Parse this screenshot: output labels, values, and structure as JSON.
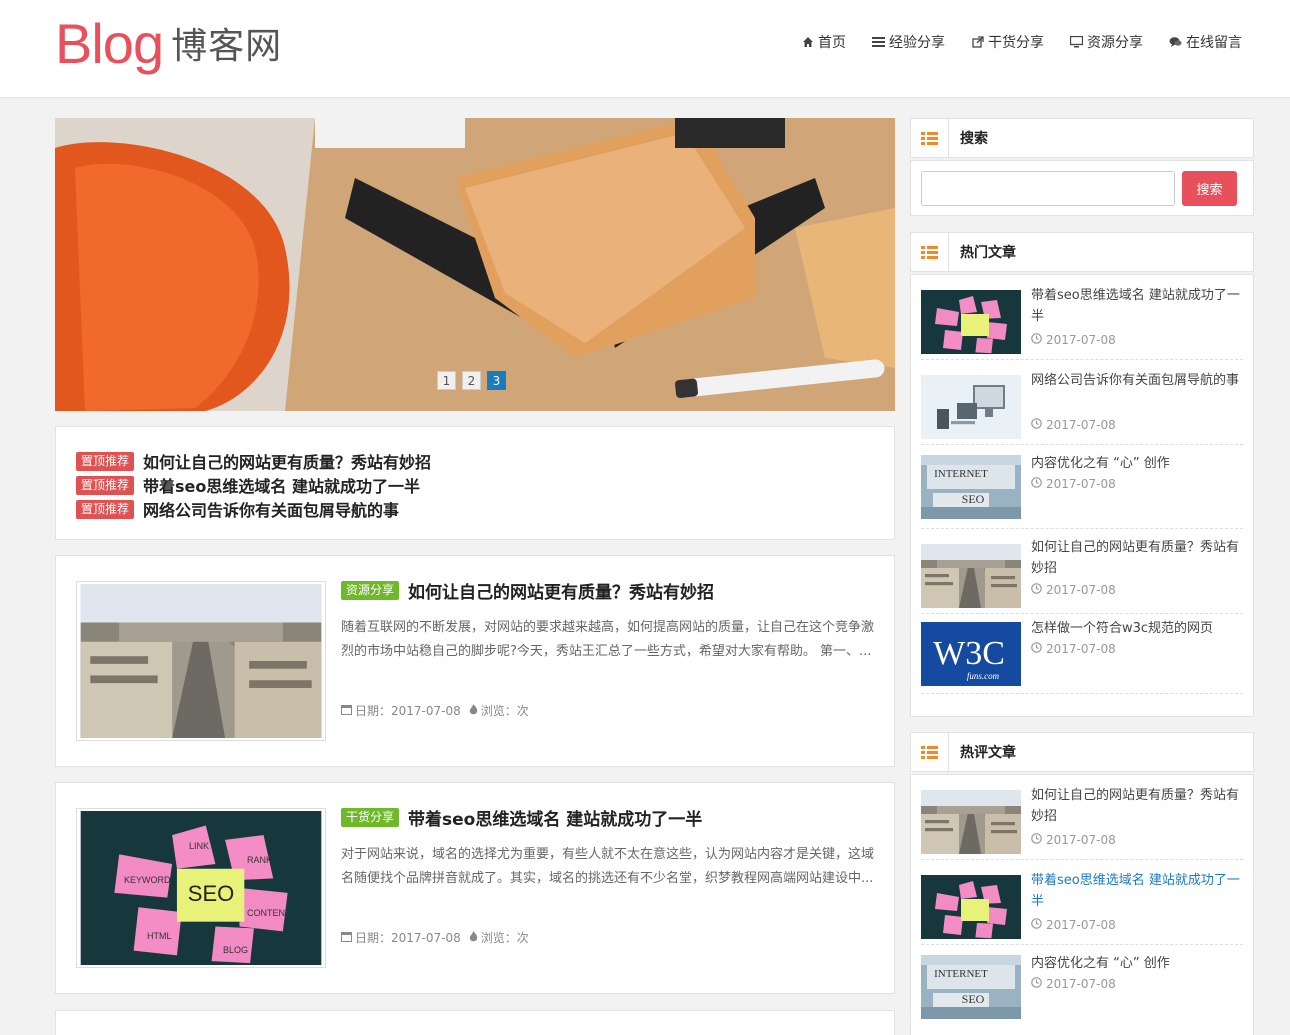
{
  "logo": {
    "latin": "Blog",
    "cn": "博客网"
  },
  "nav": [
    {
      "label": "首页",
      "icon": "home-icon"
    },
    {
      "label": "经验分享",
      "icon": "list-icon"
    },
    {
      "label": "干货分享",
      "icon": "share-icon"
    },
    {
      "label": "资源分享",
      "icon": "desktop-icon"
    },
    {
      "label": "在线留言",
      "icon": "comments-icon"
    }
  ],
  "slider": {
    "pages": [
      "1",
      "2",
      "3"
    ],
    "active": "3"
  },
  "sticky": {
    "tag": "置顶推荐",
    "items": [
      "如何让自己的网站更有质量？秀站有妙招",
      "带着seo思维选域名 建站就成功了一半",
      "网络公司告诉你有关面包屑导航的事"
    ]
  },
  "posts": [
    {
      "tag": "资源分享",
      "title": "如何让自己的网站更有质量？秀站有妙招",
      "excerpt": "随着互联网的不断发展，对网站的要求越来越高，如何提高网站的质量，让自己在这个竞争激烈的市场中站稳自己的脚步呢?今天，秀站王汇总了一些方式，希望对大家有帮助。 第一、...",
      "date": "日期：2017-07-08",
      "views": "浏览：次"
    },
    {
      "tag": "干货分享",
      "title": "带着seo思维选域名 建站就成功了一半",
      "excerpt": "对于网站来说，域名的选择尤为重要，有些人就不太在意这些，认为网站内容才是关键，这域名随便找个品牌拼音就成了。其实，域名的挑选还有不少名堂，织梦教程网高端网站建设中...",
      "date": "日期：2017-07-08",
      "views": "浏览：次"
    }
  ],
  "sidebar": {
    "search": {
      "title": "搜索",
      "button": "搜索",
      "placeholder": ""
    },
    "hot": {
      "title": "热门文章",
      "items": [
        {
          "title": "带着seo思维选域名 建站就成功了一半",
          "date": "2017-07-08"
        },
        {
          "title": "网络公司告诉你有关面包屑导航的事",
          "date": "2017-07-08"
        },
        {
          "title": "内容优化之有 “心” 创作",
          "date": "2017-07-08"
        },
        {
          "title": "如何让自己的网站更有质量？秀站有妙招",
          "date": "2017-07-08"
        },
        {
          "title": "怎样做一个符合w3c规范的网页",
          "date": "2017-07-08"
        }
      ]
    },
    "comment": {
      "title": "热评文章",
      "items": [
        {
          "title": "如何让自己的网站更有质量？秀站有妙招",
          "date": "2017-07-08"
        },
        {
          "title": "带着seo思维选域名 建站就成功了一半",
          "date": "2017-07-08"
        },
        {
          "title": "内容优化之有 “心” 创作",
          "date": "2017-07-08"
        }
      ]
    }
  },
  "thumb_text": {
    "seo_notes": [
      "LINK",
      "KEYWORD",
      "SEO",
      "RANK",
      "CONTENT",
      "HTML",
      "BLOG"
    ],
    "internet": [
      "INTERNET",
      "SEO"
    ],
    "w3c": [
      "W3C",
      "funs.com"
    ]
  },
  "colors": {
    "accent": "#e8505b",
    "tag_red": "#e05252",
    "tag_green": "#6fb829",
    "active_blue": "#1a7bbf",
    "widget_icon": "#f08a24"
  }
}
